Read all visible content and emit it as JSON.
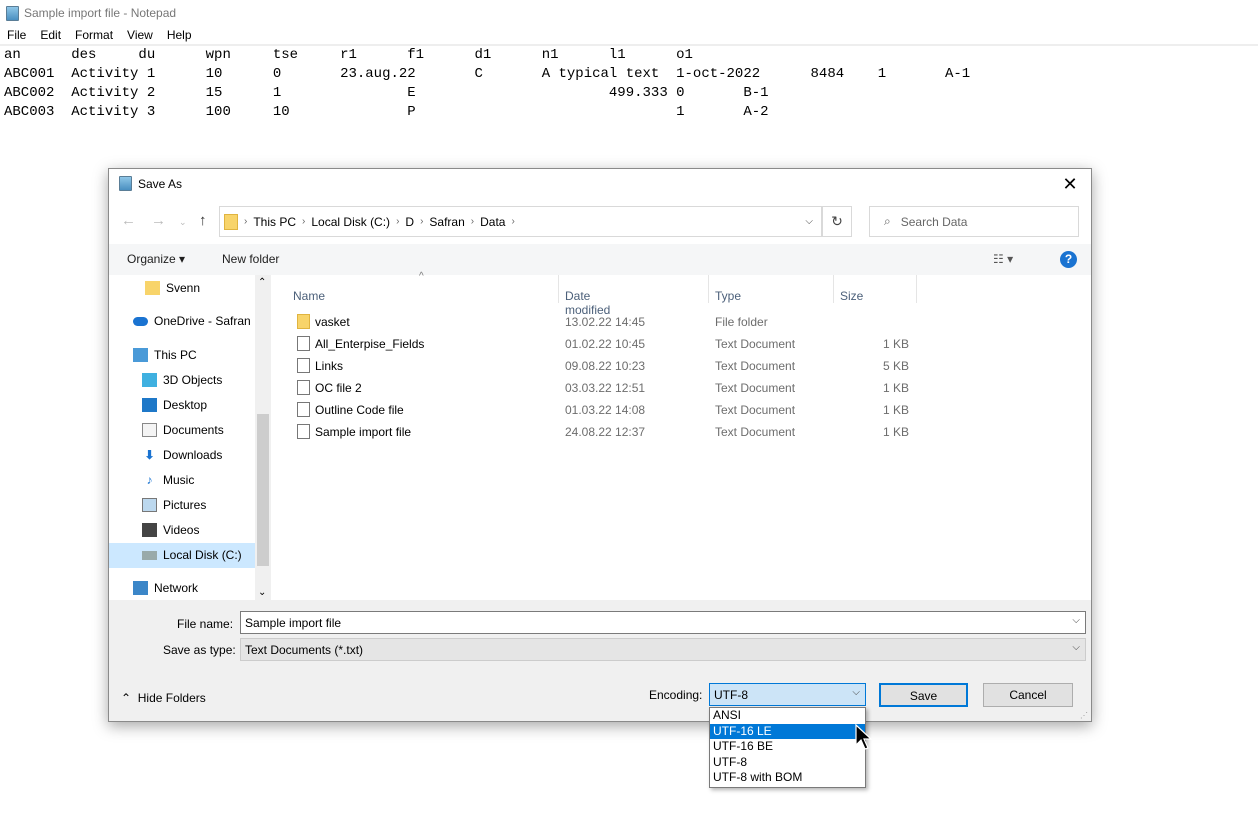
{
  "notepad": {
    "title": "Sample import file - Notepad",
    "menu": [
      "File",
      "Edit",
      "Format",
      "View",
      "Help"
    ],
    "lines": [
      "an\tdes\tdu\twpn\ttse\tr1\tf1\td1\tn1\tl1\to1",
      "ABC001\tActivity 1\t10\t0\t23.aug.22\tC\tA typical text\t1-oct-2022\t8484\t1\tA-1",
      "ABC002\tActivity 2\t15\t1\t\tE\t\t\t499.333\t0\tB-1",
      "ABC003\tActivity 3\t100\t10\t\tP\t\t\t\t1\tA-2"
    ]
  },
  "dialog": {
    "title": "Save As",
    "breadcrumb": [
      "This PC",
      "Local Disk (C:)",
      "D",
      "Safran",
      "Data"
    ],
    "search_placeholder": "Search Data",
    "organize": "Organize ▾",
    "new_folder": "New folder",
    "nav": [
      {
        "label": "Svenn",
        "icon": "folder-icon"
      },
      {
        "label": "OneDrive - Safran",
        "icon": "cloud-icon"
      },
      {
        "label": "This PC",
        "icon": "computer-icon"
      },
      {
        "label": "3D Objects",
        "icon": "cube-icon"
      },
      {
        "label": "Desktop",
        "icon": "desktop-icon"
      },
      {
        "label": "Documents",
        "icon": "document-icon"
      },
      {
        "label": "Downloads",
        "icon": "download-icon"
      },
      {
        "label": "Music",
        "icon": "music-icon"
      },
      {
        "label": "Pictures",
        "icon": "picture-icon"
      },
      {
        "label": "Videos",
        "icon": "video-icon"
      },
      {
        "label": "Local Disk (C:)",
        "icon": "drive-icon",
        "selected": true
      },
      {
        "label": "Network",
        "icon": "network-icon"
      }
    ],
    "columns": [
      "Name",
      "Date modified",
      "Type",
      "Size"
    ],
    "files": [
      {
        "name": "vasket",
        "date": "13.02.22 14:45",
        "type": "File folder",
        "size": ""
      },
      {
        "name": "All_Enterpise_Fields",
        "date": "01.02.22 10:45",
        "type": "Text Document",
        "size": "1 KB"
      },
      {
        "name": "Links",
        "date": "09.08.22 10:23",
        "type": "Text Document",
        "size": "5 KB"
      },
      {
        "name": "OC file 2",
        "date": "03.03.22 12:51",
        "type": "Text Document",
        "size": "1 KB"
      },
      {
        "name": "Outline Code file",
        "date": "01.03.22 14:08",
        "type": "Text Document",
        "size": "1 KB"
      },
      {
        "name": "Sample import file",
        "date": "24.08.22 12:37",
        "type": "Text Document",
        "size": "1 KB"
      }
    ],
    "file_name_label": "File name:",
    "file_name": "Sample import file",
    "save_type_label": "Save as type:",
    "save_type": "Text Documents (*.txt)",
    "hide_folders": "Hide Folders",
    "encoding_label": "Encoding:",
    "encoding": "UTF-8",
    "encoding_options": [
      "ANSI",
      "UTF-16 LE",
      "UTF-16 BE",
      "UTF-8",
      "UTF-8 with BOM"
    ],
    "encoding_highlighted": "UTF-16 LE",
    "save": "Save",
    "cancel": "Cancel"
  }
}
